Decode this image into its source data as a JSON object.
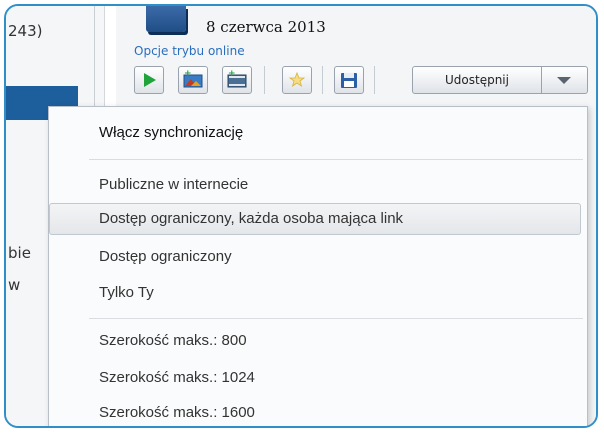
{
  "left_fragments": {
    "top": "243)",
    "mid1": "bie",
    "mid2": "w"
  },
  "header": {
    "date": "8 czerwca 2013",
    "online_options_link": "Opcje trybu online"
  },
  "toolbar": {
    "buttons": [
      {
        "icon": "play-icon"
      },
      {
        "icon": "add-photo-icon"
      },
      {
        "icon": "add-video-icon"
      },
      {
        "icon": "star-icon"
      },
      {
        "icon": "save-icon"
      }
    ],
    "share_label": "Udostępnij"
  },
  "menu": {
    "sync": "Włącz synchronizację",
    "public": "Publiczne w internecie",
    "restricted_link": "Dostęp ograniczony, każda osoba mająca link",
    "restricted": "Dostęp ograniczony",
    "only_you": "Tylko Ty",
    "width_800": "Szerokość maks.: 800",
    "width_1024": "Szerokość maks.: 1024",
    "width_1600": "Szerokość maks.: 1600"
  },
  "colors": {
    "frame": "#2f8fc6",
    "link": "#2a6ebd",
    "play": "#1fa33a",
    "star": "#f1c232",
    "save": "#2c5fa6"
  }
}
